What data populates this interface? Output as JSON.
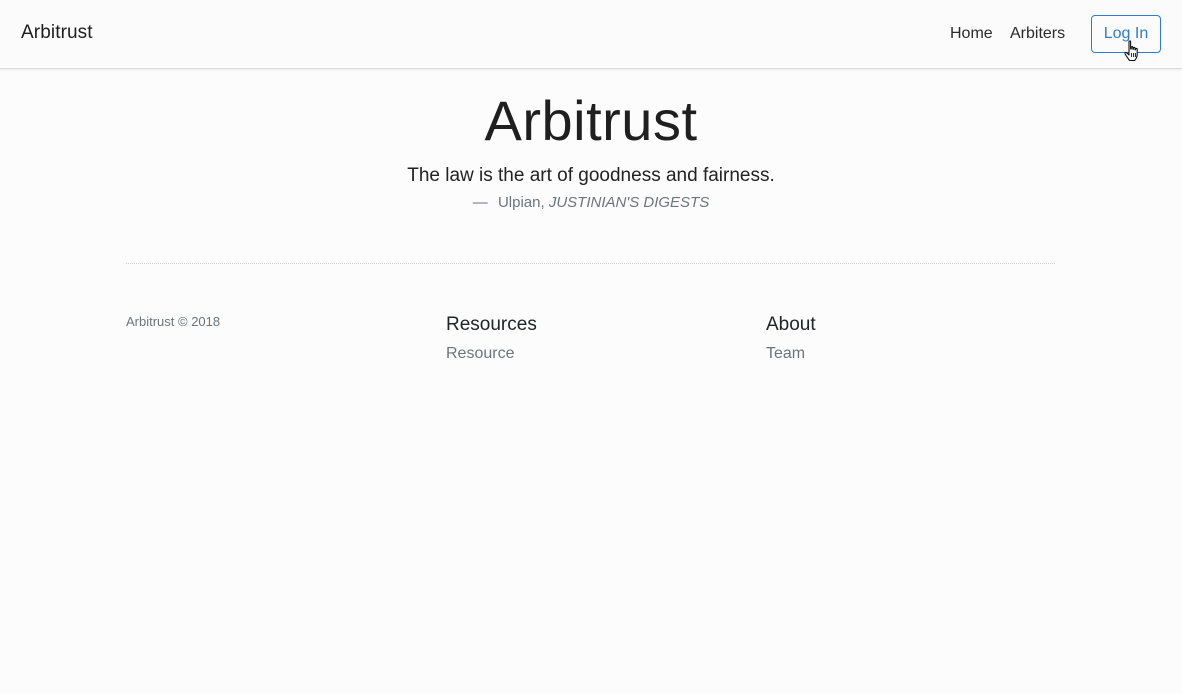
{
  "navbar": {
    "brand": "Arbitrust",
    "links": [
      {
        "label": "Home"
      },
      {
        "label": "Arbiters"
      }
    ],
    "login_label": "Log In"
  },
  "hero": {
    "title": "Arbitrust",
    "quote": "The law is the art of goodness and fairness.",
    "attribution_dash": "—",
    "attribution_author": "Ulpian,",
    "attribution_source": "JUSTINIAN'S DIGESTS"
  },
  "footer": {
    "copyright": "Arbitrust © 2018",
    "columns": [
      {
        "heading": "Resources",
        "links": [
          "Resource"
        ]
      },
      {
        "heading": "About",
        "links": [
          "Team"
        ]
      }
    ]
  },
  "colors": {
    "accent": "#2f7bd3",
    "muted": "#6c757d",
    "text": "#212529",
    "background": "#fcfcfc"
  },
  "icons": {
    "cursor": "hand-pointer-icon"
  }
}
